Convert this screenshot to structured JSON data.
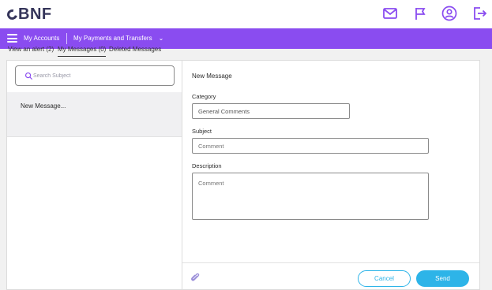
{
  "brand": {
    "logo_text": "BNF"
  },
  "nav": {
    "my_accounts": "My Accounts",
    "payments": "My Payments and Transfers"
  },
  "tabs": [
    {
      "label": "View an alert (2)"
    },
    {
      "label": "My Messages (0)"
    },
    {
      "label": "Deleted Messages"
    }
  ],
  "search": {
    "placeholder": "Search Subject"
  },
  "messages": [
    {
      "label": "New Message..."
    }
  ],
  "form": {
    "title": "New Message",
    "category_label": "Category",
    "category_value": "General Comments",
    "subject_label": "Subject",
    "subject_placeholder": "Comment",
    "description_label": "Description",
    "description_placeholder": "Comment",
    "cancel_label": "Cancel",
    "send_label": "Send"
  },
  "colors": {
    "nav_bg": "#8a4cf0",
    "accent": "#2db4e8",
    "icon": "#8a4cf0",
    "logo": "#35355a"
  },
  "icons": [
    "mail-icon",
    "flag-icon",
    "user-icon",
    "logout-icon",
    "search-icon",
    "paperclip-icon",
    "chevron-down-icon",
    "menu-icon"
  ]
}
